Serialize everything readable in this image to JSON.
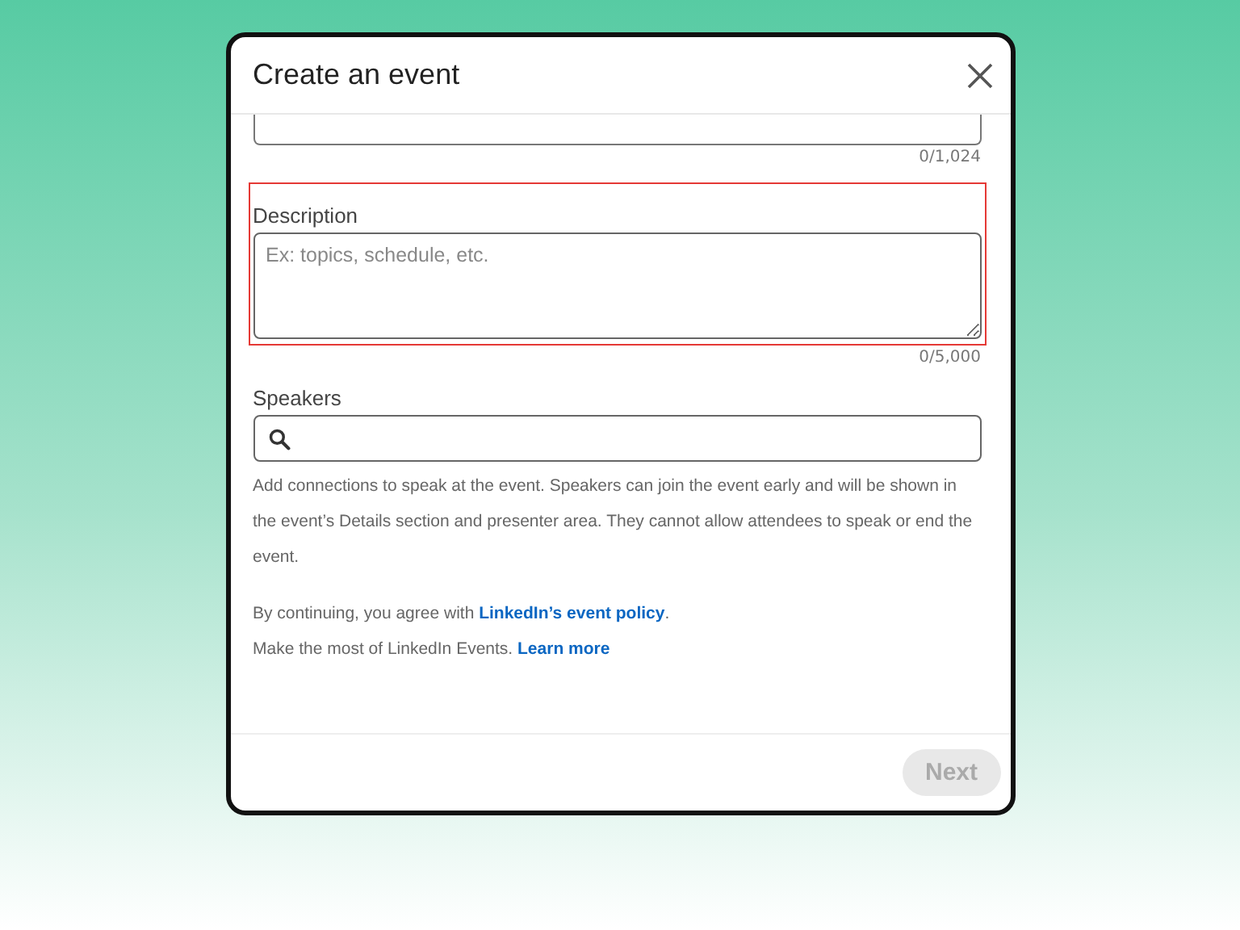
{
  "dialog": {
    "title": "Create an event"
  },
  "top_field": {
    "counter": "0/1,024"
  },
  "description": {
    "label": "Description",
    "placeholder": "Ex: topics, schedule, etc.",
    "counter": "0/5,000",
    "highlighted": true
  },
  "speakers": {
    "label": "Speakers",
    "help": "Add connections to speak at the event. Speakers can join the event early and will be shown in the event’s Details section and presenter area. They cannot allow attendees to speak or end the event."
  },
  "policy": {
    "text": "By continuing, you agree with ",
    "link": "LinkedIn’s event policy",
    "suffix": "."
  },
  "promo": {
    "text": "Make the most of LinkedIn Events. ",
    "link": "Learn more"
  },
  "footer": {
    "next": {
      "label": "Next",
      "disabled": true
    }
  }
}
